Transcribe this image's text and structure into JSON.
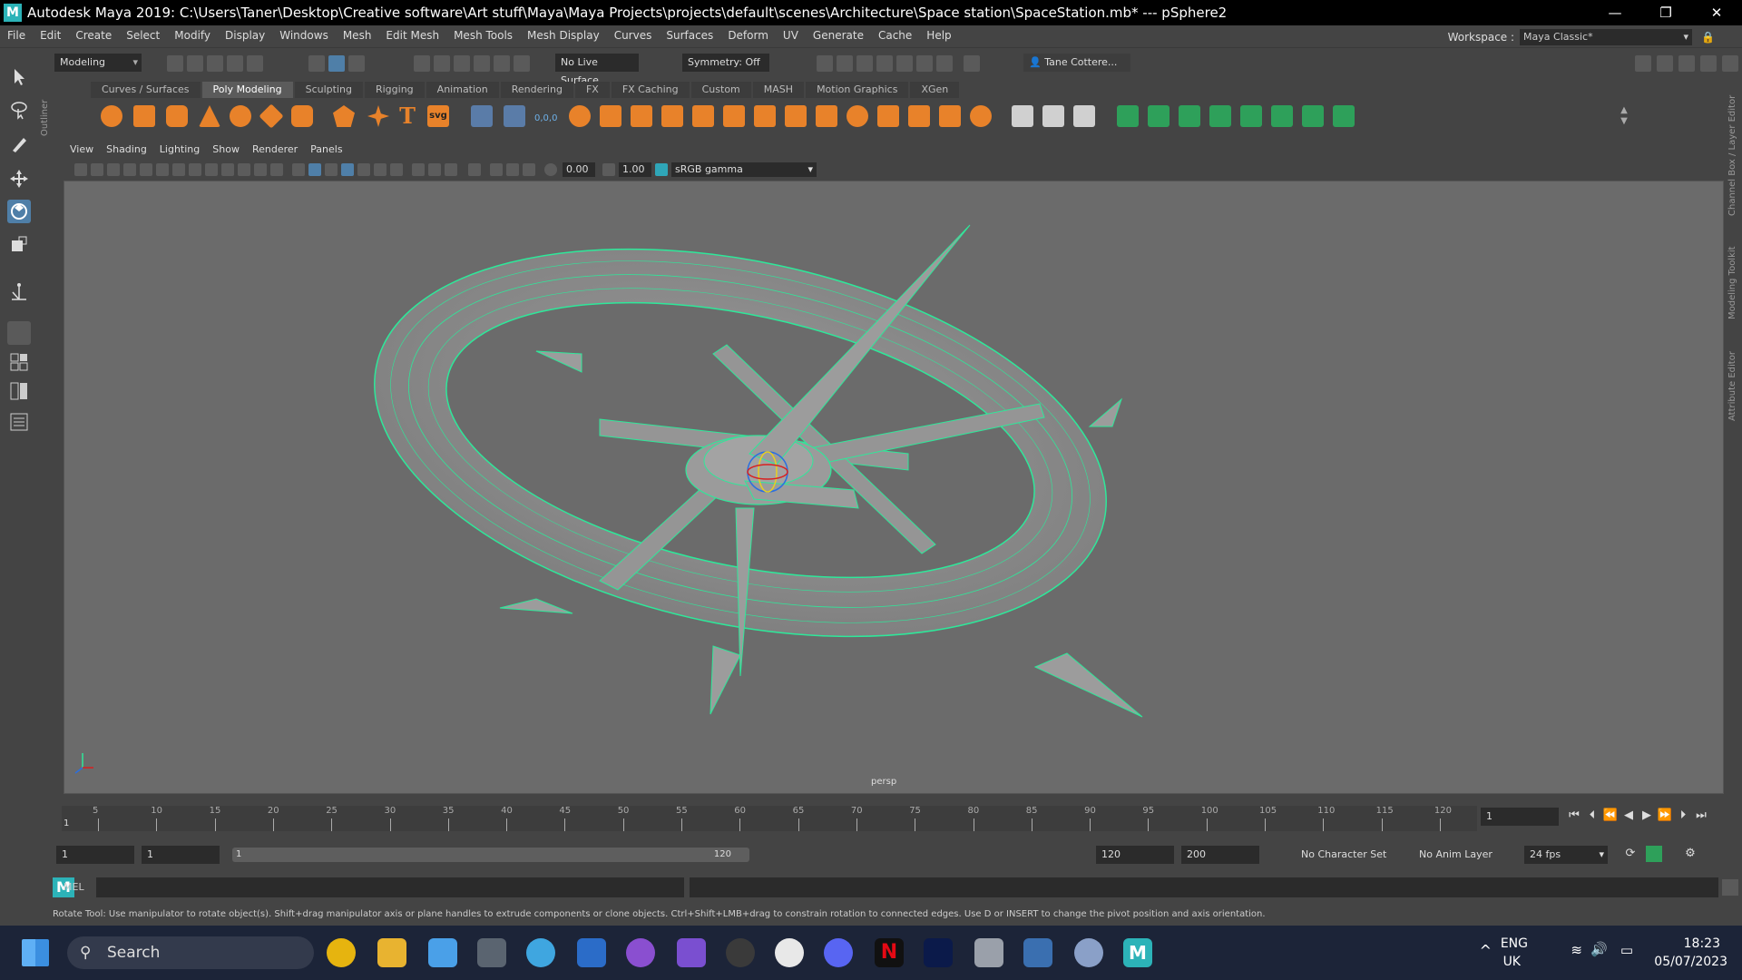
{
  "window": {
    "title": "Autodesk Maya 2019: C:\\Users\\Taner\\Desktop\\Creative software\\Art stuff\\Maya\\Maya Projects\\projects\\default\\scenes\\Architecture\\Space station\\SpaceStation.mb*   ---   pSphere2",
    "minimize": "—",
    "restore": "❐",
    "close": "✕"
  },
  "menubar": [
    "File",
    "Edit",
    "Create",
    "Select",
    "Modify",
    "Display",
    "Windows",
    "Mesh",
    "Edit Mesh",
    "Mesh Tools",
    "Mesh Display",
    "Curves",
    "Surfaces",
    "Deform",
    "UV",
    "Generate",
    "Cache",
    "Help"
  ],
  "workspace": {
    "label": "Workspace :",
    "value": "Maya Classic*"
  },
  "statusline": {
    "mode": "Modeling",
    "live_surface": "No Live Surface",
    "symmetry": "Symmetry: Off",
    "user": "Tane Cottere..."
  },
  "shelf_tabs": [
    {
      "label": "Curves / Surfaces",
      "active": false
    },
    {
      "label": "Poly Modeling",
      "active": true
    },
    {
      "label": "Sculpting",
      "active": false
    },
    {
      "label": "Rigging",
      "active": false
    },
    {
      "label": "Animation",
      "active": false
    },
    {
      "label": "Rendering",
      "active": false
    },
    {
      "label": "FX",
      "active": false
    },
    {
      "label": "FX Caching",
      "active": false
    },
    {
      "label": "Custom",
      "active": false
    },
    {
      "label": "MASH",
      "active": false
    },
    {
      "label": "Motion Graphics",
      "active": false
    },
    {
      "label": "XGen",
      "active": false
    }
  ],
  "shelf_icon_labels": {
    "type_tool": "T",
    "svg_tool": "svg",
    "snap_label": "0,0,0"
  },
  "side_tabs": {
    "outliner": "Outliner",
    "channel_box": "Channel Box / Layer Editor",
    "modeling_toolkit": "Modeling Toolkit",
    "attribute_editor": "Attribute Editor"
  },
  "panel_menu": [
    "View",
    "Shading",
    "Lighting",
    "Show",
    "Renderer",
    "Panels"
  ],
  "panel_bar": {
    "exposure": "0.00",
    "gamma": "1.00",
    "color_space": "sRGB gamma"
  },
  "viewport": {
    "camera_label": "persp"
  },
  "timeline": {
    "ticks": [
      "5",
      "10",
      "15",
      "20",
      "25",
      "30",
      "35",
      "40",
      "45",
      "50",
      "55",
      "60",
      "65",
      "70",
      "75",
      "80",
      "85",
      "90",
      "95",
      "100",
      "105",
      "110",
      "115",
      "120"
    ],
    "start": "1",
    "current_frame": "1"
  },
  "range": {
    "start_time": "1",
    "playback_start": "1",
    "slider_start": "1",
    "slider_end": "120",
    "playback_end": "120",
    "end_time": "200",
    "character_set": "No Character Set",
    "anim_layer": "No Anim Layer",
    "fps": "24 fps"
  },
  "command_line": {
    "language": "MEL"
  },
  "help_line": "Rotate Tool: Use manipulator to rotate object(s). Shift+drag manipulator axis or plane handles to extrude components or clone objects. Ctrl+Shift+LMB+drag to constrain rotation to connected edges. Use D or INSERT to change the pivot position and axis orientation.",
  "taskbar": {
    "search": "Search",
    "lang": "ENG",
    "region": "UK",
    "time": "18:23",
    "date": "05/07/2023"
  },
  "colors": {
    "wire": "#2ee89a",
    "mesh": "#8a8a8a",
    "viewport_bg": "#6b6b6b"
  }
}
